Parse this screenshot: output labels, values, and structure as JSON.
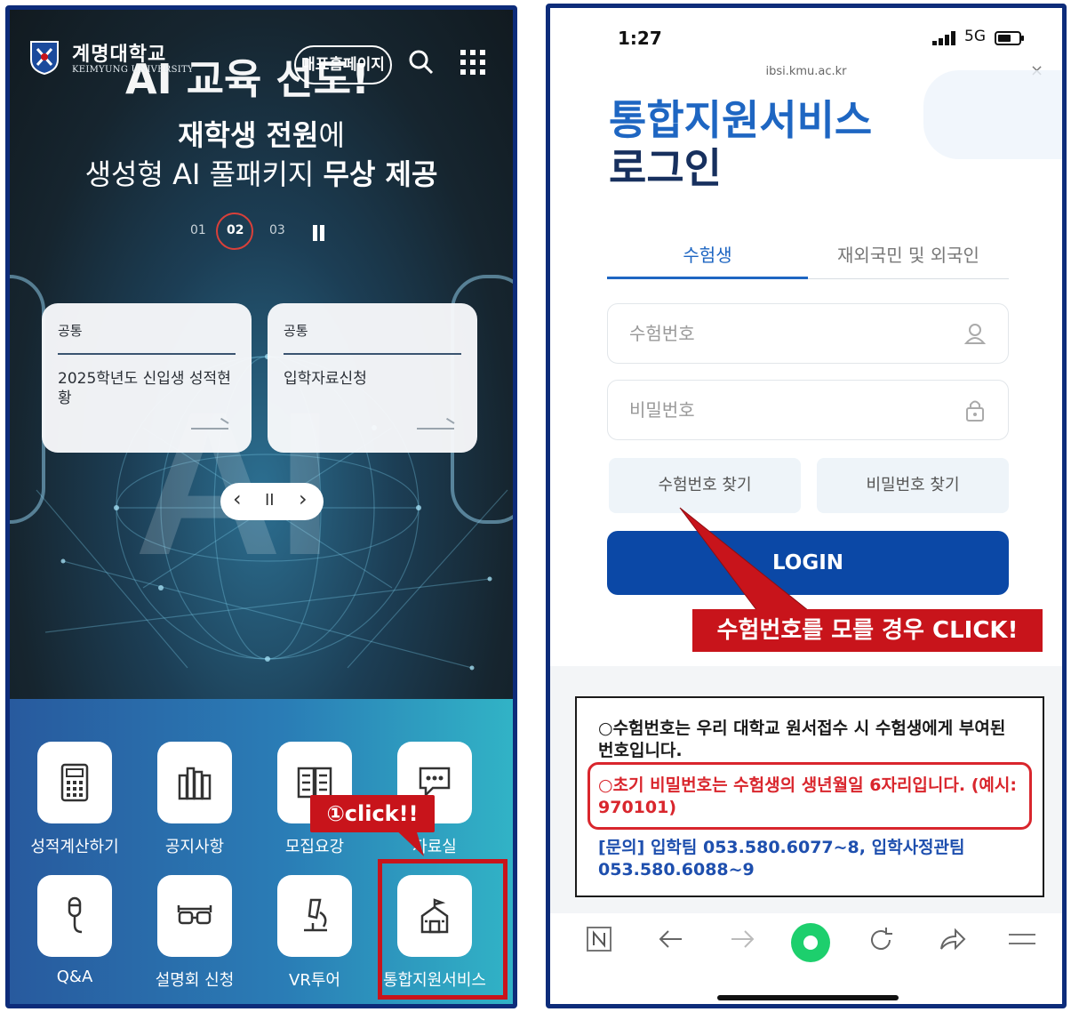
{
  "left_screen": {
    "logo": {
      "name_kr": "계명대학교",
      "name_en": "KEIMYUNG UNIVERSITY"
    },
    "hero": {
      "headline": "AI 교육 선도!",
      "line1_bold": "재학생 전원",
      "line1_rest": "에",
      "line2_normal": "생성형 AI 풀패키지 ",
      "line2_bold": "무상 제공",
      "big_text": "AI",
      "pager": [
        "01",
        "02",
        "03"
      ],
      "active_page": "02"
    },
    "english_button": "대표홈페이지",
    "cards": [
      {
        "tag": "공통",
        "title": "2025학년도 신입생 성적현황"
      },
      {
        "tag": "공통",
        "title": "입학자료신청"
      }
    ],
    "slider_controls": {
      "prev": "‹",
      "pause": "II",
      "next": "›"
    },
    "quick_menu": [
      {
        "label": "성적계산하기",
        "icon": "calculator-icon"
      },
      {
        "label": "공지사항",
        "icon": "books-icon"
      },
      {
        "label": "모집요강",
        "icon": "open-book-icon"
      },
      {
        "label": "자료실",
        "icon": "chat-bubble-icon"
      },
      {
        "label": "Q&A",
        "icon": "microphone-icon"
      },
      {
        "label": "설명회 신청",
        "icon": "glasses-icon"
      },
      {
        "label": "VR투어",
        "icon": "microscope-icon"
      },
      {
        "label": "통합지원서비스",
        "icon": "school-icon"
      }
    ],
    "callout": "①click!!",
    "colors": {
      "highlight": "#c8141b",
      "quick_bg_start": "#285a9e",
      "quick_bg_end": "#31b3c6"
    }
  },
  "right_screen": {
    "status": {
      "time": "1:27",
      "network": "5G"
    },
    "url": "ibsi.kmu.ac.kr",
    "title_line1": "통합지원서비스",
    "title_line2": "로그인",
    "tabs": [
      "수험생",
      "재외국민 및 외국인"
    ],
    "active_tab": "수험생",
    "fields": {
      "exam_no_placeholder": "수험번호",
      "password_placeholder": "비밀번호"
    },
    "find_buttons": [
      "수험번호 찾기",
      "비밀번호 찾기"
    ],
    "login_button": "LOGIN",
    "callout": "수험번호를 모를 경우 CLICK!",
    "notices": [
      "○수험번호는 우리 대학교 원서접수 시 수험생에게 부여된 번호입니다.",
      "○초기 비밀번호는 수험생의 생년월일 6자리입니다. (예시: 970101)",
      "[문의] 입학팀 053.580.6077~8, 입학사정관팀 053.580.6088~9"
    ],
    "colors": {
      "title_blue": "#1e66c2",
      "title_navy": "#17305e",
      "login_bg": "#0b48a6",
      "alert_red": "#d9262d"
    }
  }
}
